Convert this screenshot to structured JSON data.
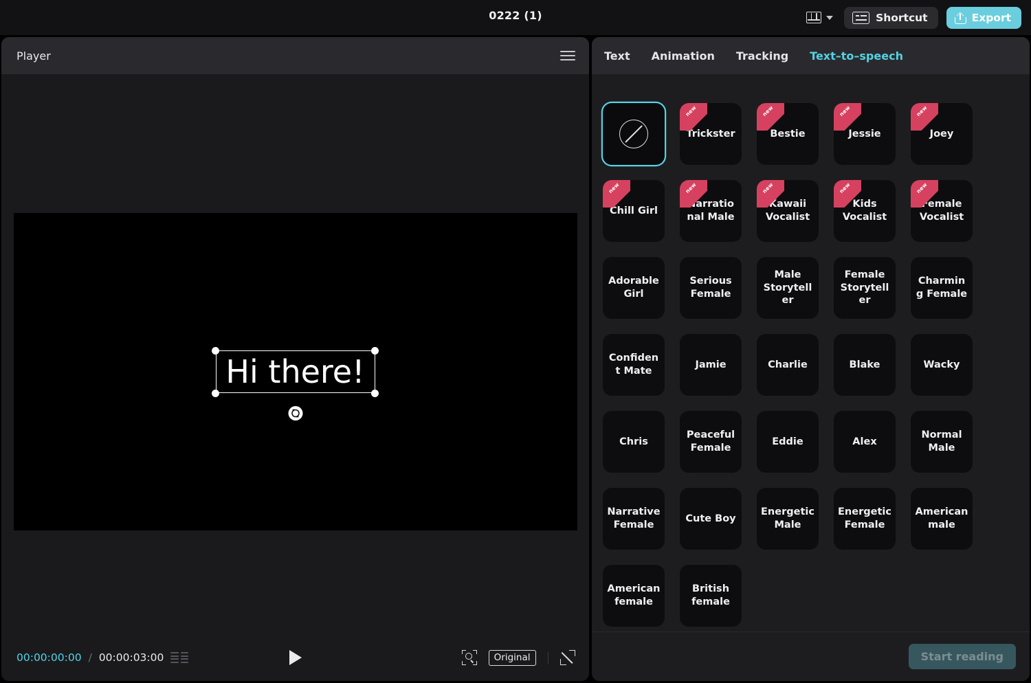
{
  "header": {
    "title": "0222 (1)",
    "layout_icon": "layout-panel-icon",
    "layout_chevron": "chevron-down-icon",
    "shortcut_label": "Shortcut",
    "shortcut_icon": "keyboard-icon",
    "export_label": "Export",
    "export_icon": "upload-icon",
    "export_color": "#6ACEDE"
  },
  "player": {
    "title": "Player",
    "menu_icon": "hamburger-menu-icon",
    "canvas_text": "Hi there!",
    "rotate_icon": "rotate-handle-icon",
    "current_time": "00:00:00:00",
    "time_separator": "/",
    "total_time": "00:00:03:00",
    "time_accent_color": "#4FD4E4",
    "list_icon": "list-view-icon",
    "play_icon": "play-icon",
    "zoom_fit_icon": "zoom-to-fit-icon",
    "original_label": "Original",
    "fullscreen_icon": "fullscreen-icon"
  },
  "right_panel": {
    "accent_color": "#54D2E3",
    "tabs": [
      {
        "label": "Text",
        "active": false
      },
      {
        "label": "Animation",
        "active": false
      },
      {
        "label": "Tracking",
        "active": false
      },
      {
        "label": "Text–to–speech",
        "active": true
      }
    ],
    "badge_label": "new",
    "badge_color": "#D6415F",
    "voices": [
      {
        "label": "",
        "icon": "no-voice-icon",
        "selected": true,
        "new": false
      },
      {
        "label": "Trickster",
        "selected": false,
        "new": true
      },
      {
        "label": "Bestie",
        "selected": false,
        "new": true
      },
      {
        "label": "Jessie",
        "selected": false,
        "new": true
      },
      {
        "label": "Joey",
        "selected": false,
        "new": true
      },
      {
        "label": "Chill Girl",
        "selected": false,
        "new": true
      },
      {
        "label": "Narrational Male",
        "selected": false,
        "new": true
      },
      {
        "label": "Kawaii Vocalist",
        "selected": false,
        "new": true
      },
      {
        "label": "Kids Vocalist",
        "selected": false,
        "new": true
      },
      {
        "label": "Female Vocalist",
        "selected": false,
        "new": true
      },
      {
        "label": "Adorable Girl",
        "selected": false,
        "new": false
      },
      {
        "label": "Serious Female",
        "selected": false,
        "new": false
      },
      {
        "label": "Male Storyteller",
        "selected": false,
        "new": false
      },
      {
        "label": "Female Storyteller",
        "selected": false,
        "new": false
      },
      {
        "label": "Charming Female",
        "selected": false,
        "new": false
      },
      {
        "label": "Confident Mate",
        "selected": false,
        "new": false
      },
      {
        "label": "Jamie",
        "selected": false,
        "new": false
      },
      {
        "label": "Charlie",
        "selected": false,
        "new": false
      },
      {
        "label": "Blake",
        "selected": false,
        "new": false
      },
      {
        "label": "Wacky",
        "selected": false,
        "new": false
      },
      {
        "label": "Chris",
        "selected": false,
        "new": false
      },
      {
        "label": "Peaceful Female",
        "selected": false,
        "new": false
      },
      {
        "label": "Eddie",
        "selected": false,
        "new": false
      },
      {
        "label": "Alex",
        "selected": false,
        "new": false
      },
      {
        "label": "Normal Male",
        "selected": false,
        "new": false
      },
      {
        "label": "Narrative Female",
        "selected": false,
        "new": false
      },
      {
        "label": "Cute Boy",
        "selected": false,
        "new": false
      },
      {
        "label": "Energetic Male",
        "selected": false,
        "new": false
      },
      {
        "label": "Energetic Female",
        "selected": false,
        "new": false
      },
      {
        "label": "American male",
        "selected": false,
        "new": false
      },
      {
        "label": "American female",
        "selected": false,
        "new": false
      },
      {
        "label": "British female",
        "selected": false,
        "new": false
      }
    ],
    "start_reading_label": "Start reading",
    "start_reading_enabled": false
  }
}
